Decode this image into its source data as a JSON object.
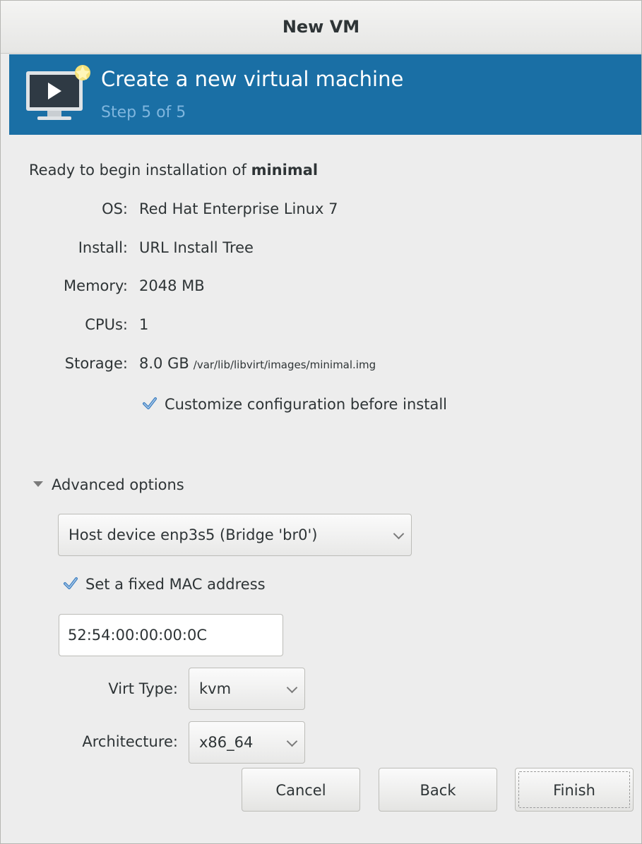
{
  "window": {
    "title": "New VM"
  },
  "banner": {
    "title": "Create a new virtual machine",
    "step": "Step 5 of 5",
    "color": "#1a6fa5",
    "icon": "vm-monitor-icon"
  },
  "summary": {
    "ready_prefix": "Ready to begin installation of",
    "vm_name": "minimal",
    "rows": [
      {
        "label": "OS:",
        "value": "Red Hat Enterprise Linux 7"
      },
      {
        "label": "Install:",
        "value": "URL Install Tree"
      },
      {
        "label": "Memory:",
        "value": "2048 MB"
      },
      {
        "label": "CPUs:",
        "value": "1"
      },
      {
        "label": "Storage:",
        "value": "8.0 GB",
        "path": "/var/lib/libvirt/images/minimal.img"
      }
    ],
    "customize_label": "Customize configuration before install",
    "customize_checked": true
  },
  "advanced": {
    "expander_label": "Advanced options",
    "expanded": true,
    "network_source": "Host device enp3s5 (Bridge 'br0')",
    "fixed_mac_label": "Set a fixed MAC address",
    "fixed_mac_checked": true,
    "mac_address": "52:54:00:00:00:0C",
    "virt_type_label": "Virt Type:",
    "virt_type_value": "kvm",
    "arch_label": "Architecture:",
    "arch_value": "x86_64"
  },
  "buttons": {
    "cancel": "Cancel",
    "back": "Back",
    "finish": "Finish"
  }
}
